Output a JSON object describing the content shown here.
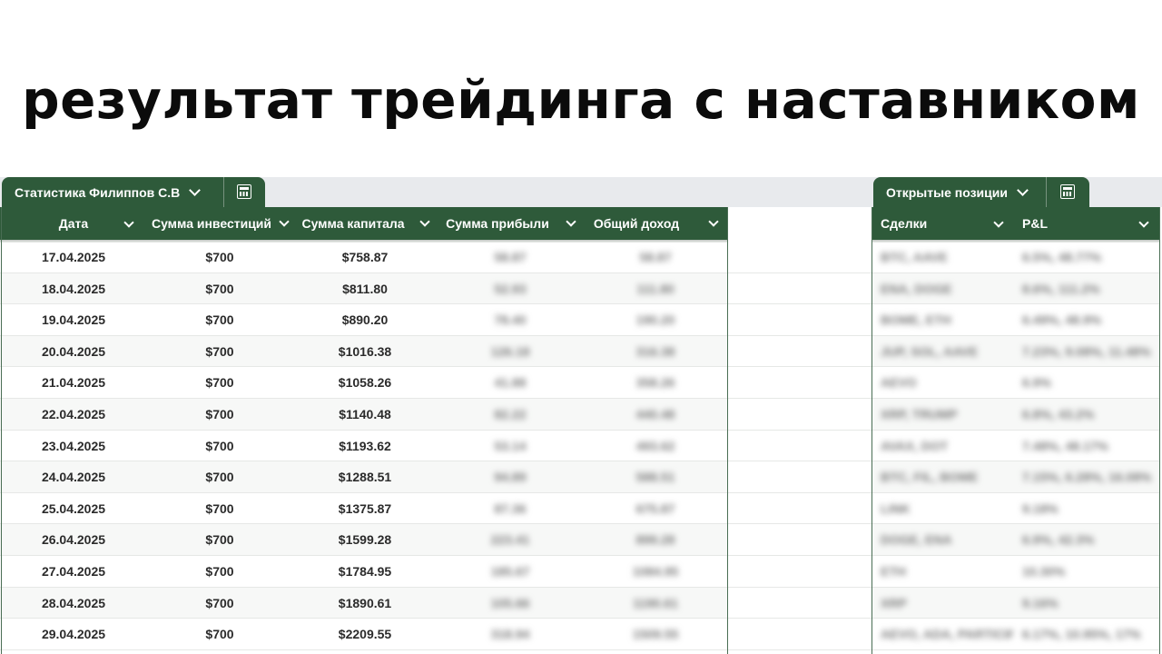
{
  "headline": "результат трейдинга с наставником",
  "left_tab": {
    "label": "Статистика Филиппов С.В"
  },
  "right_tab": {
    "label": "Открытые позиции"
  },
  "left_columns": [
    "Дата",
    "Сумма инвестиций",
    "Сумма капитала",
    "Сумма прибыли",
    "Общий доход"
  ],
  "right_columns": [
    "Сделки",
    "P&L"
  ],
  "rows": [
    {
      "date": "17.04.2025",
      "invest": "$700",
      "capital": "$758.87",
      "profit": "58.87",
      "income": "58.87",
      "deals": "BTC, AAVE",
      "pnl": "6.5%, 48.77%"
    },
    {
      "date": "18.04.2025",
      "invest": "$700",
      "capital": "$811.80",
      "profit": "52.93",
      "income": "111.80",
      "deals": "ENA, DOGE",
      "pnl": "8.6%, 111.2%"
    },
    {
      "date": "19.04.2025",
      "invest": "$700",
      "capital": "$890.20",
      "profit": "78.40",
      "income": "190.20",
      "deals": "BOME, ETH",
      "pnl": "6.49%, 48.9%"
    },
    {
      "date": "20.04.2025",
      "invest": "$700",
      "capital": "$1016.38",
      "profit": "126.18",
      "income": "316.38",
      "deals": "JUP, SOL, AAVE",
      "pnl": "7.23%, 9.08%, 11.48%"
    },
    {
      "date": "21.04.2025",
      "invest": "$700",
      "capital": "$1058.26",
      "profit": "41.88",
      "income": "358.26",
      "deals": "AEVO",
      "pnl": "6.9%"
    },
    {
      "date": "22.04.2025",
      "invest": "$700",
      "capital": "$1140.48",
      "profit": "82.22",
      "income": "440.48",
      "deals": "XRP, TRUMP",
      "pnl": "6.8%, 43.2%"
    },
    {
      "date": "23.04.2025",
      "invest": "$700",
      "capital": "$1193.62",
      "profit": "53.14",
      "income": "493.62",
      "deals": "AVAX, DOT",
      "pnl": "7.48%, 48.17%"
    },
    {
      "date": "24.04.2025",
      "invest": "$700",
      "capital": "$1288.51",
      "profit": "94.89",
      "income": "588.51",
      "deals": "BTC, FIL, BOME",
      "pnl": "7.15%, 6.28%, 16.08%"
    },
    {
      "date": "25.04.2025",
      "invest": "$700",
      "capital": "$1375.87",
      "profit": "87.36",
      "income": "675.87",
      "deals": "LINK",
      "pnl": "9.18%"
    },
    {
      "date": "26.04.2025",
      "invest": "$700",
      "capital": "$1599.28",
      "profit": "223.41",
      "income": "899.28",
      "deals": "DOGE, ENA",
      "pnl": "6.9%, 42.3%"
    },
    {
      "date": "27.04.2025",
      "invest": "$700",
      "capital": "$1784.95",
      "profit": "185.67",
      "income": "1084.95",
      "deals": "ETH",
      "pnl": "10.30%"
    },
    {
      "date": "28.04.2025",
      "invest": "$700",
      "capital": "$1890.61",
      "profit": "105.66",
      "income": "1190.61",
      "deals": "XRP",
      "pnl": "9.16%"
    },
    {
      "date": "29.04.2025",
      "invest": "$700",
      "capital": "$2209.55",
      "profit": "318.94",
      "income": "1509.55",
      "deals": "AEVO, ADA, PARTICIPANT",
      "pnl": "6.17%, 10.95%, 17%"
    }
  ]
}
